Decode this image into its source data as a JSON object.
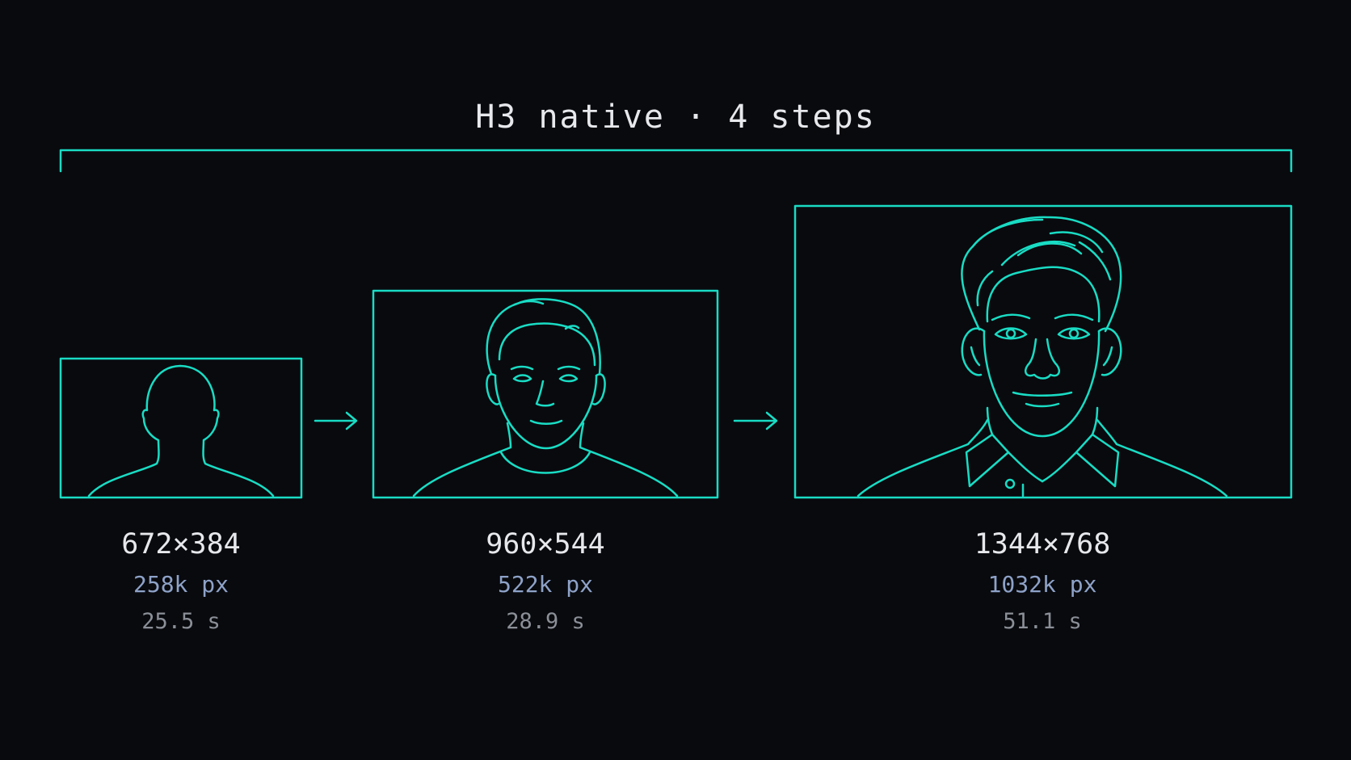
{
  "title": "H3 native · 4 steps",
  "accent_color": "#19dcc4",
  "stages": [
    {
      "resolution": "672×384",
      "pixels": "258k px",
      "time": "25.5 s",
      "illustration": "silhouette-portrait"
    },
    {
      "resolution": "960×544",
      "pixels": "522k px",
      "time": "28.9 s",
      "illustration": "simple-face-portrait"
    },
    {
      "resolution": "1344×768",
      "pixels": "1032k px",
      "time": "51.1 s",
      "illustration": "detailed-face-portrait"
    }
  ]
}
